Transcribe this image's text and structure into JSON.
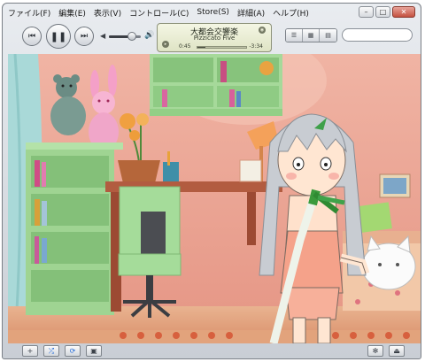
{
  "menu": {
    "items": [
      "ファイル(F)",
      "編集(E)",
      "表示(V)",
      "コントロール(C)",
      "Store(S)",
      "詳細(A)",
      "ヘルプ(H)"
    ]
  },
  "window_controls": {
    "minimize": "–",
    "maximize": "□",
    "close": "✕"
  },
  "player": {
    "prev_glyph": "⏮",
    "play_pause_glyph": "❚❚",
    "next_glyph": "⏭",
    "volume_level": 0.72,
    "volume_low_glyph": "◀",
    "volume_high_glyph": "🔊"
  },
  "now_playing": {
    "title": "大都会交響楽",
    "artist": "Pizzicato Five",
    "elapsed": "0:45",
    "remaining": "-3:34",
    "progress": 0.17
  },
  "view_buttons": [
    "☰",
    "▦",
    "▤"
  ],
  "search": {
    "placeholder": "",
    "value": ""
  },
  "bottom_buttons": {
    "add": "+",
    "shuffle": "⤮",
    "repeat": "⟳",
    "artwork": "▣",
    "visualizer": "✻",
    "eject": "⏏"
  },
  "colors": {
    "accent_blue": "#1d67d9",
    "wall_pink": "#e89e8e",
    "shelf_green": "#a6d99a"
  }
}
